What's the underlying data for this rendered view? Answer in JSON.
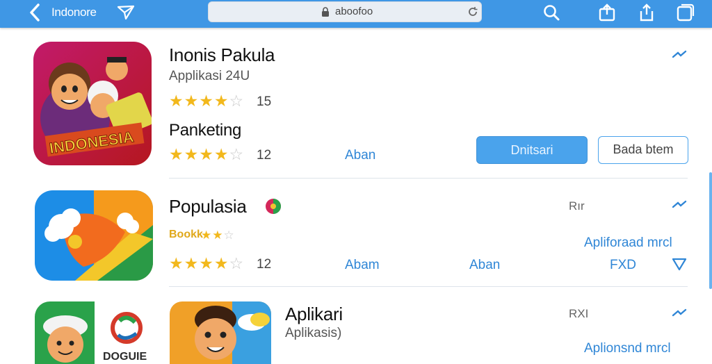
{
  "topbar": {
    "back_label": "Indonore",
    "address": "aboofoo"
  },
  "apps": [
    {
      "title": "Inonis Pakula",
      "subtitle": "Applikasi 24U",
      "rating": 4,
      "rating_count": "15",
      "section_label": "Panketing",
      "section_rating": 4,
      "section_count": "12",
      "link_a": "Aban",
      "button_primary": "Dnitsari",
      "button_secondary": "Bada btem"
    },
    {
      "title": "Populasia",
      "meta_small": "Rır",
      "sub_rating_label": "Bookk",
      "sub_rating": 3,
      "link_right": "Apliforaad mrcl",
      "rating": 4,
      "rating_count": "12",
      "link_a": "Abam",
      "link_b": "Aban",
      "link_c": "FXD"
    },
    {
      "title": "Aplikari",
      "subtitle": "Aplikasis)",
      "meta_small": "RXI",
      "link_right": "Aplionsnd mrcl",
      "icon_caption": "DOGUIE"
    }
  ],
  "colors": {
    "topbar": "#3f97e5",
    "accent": "#2f86d6",
    "star": "#f2b81c"
  }
}
